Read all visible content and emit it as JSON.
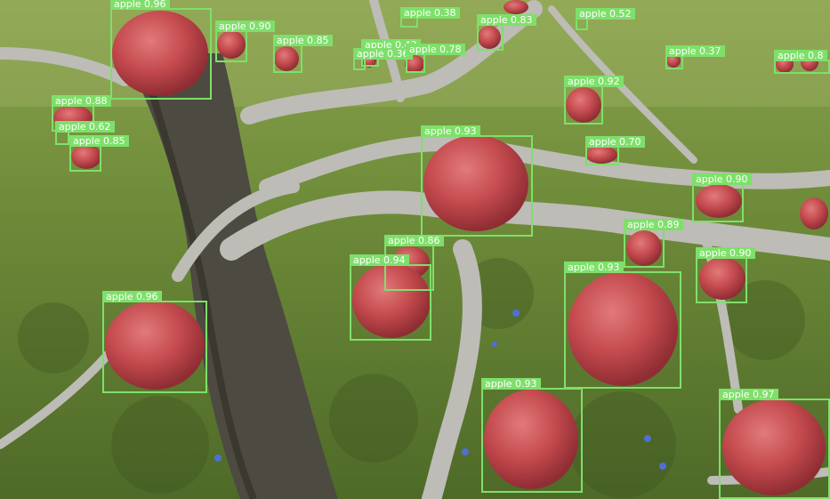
{
  "detections": [
    {
      "label": "apple",
      "score": "0.96"
    },
    {
      "label": "apple",
      "score": "0.90"
    },
    {
      "label": "apple",
      "score": "0.85"
    },
    {
      "label": "apple",
      "score": "0.43"
    },
    {
      "label": "apple",
      "score": "0.36"
    },
    {
      "label": "apple",
      "score": "0.78"
    },
    {
      "label": "apple",
      "score": "0.38"
    },
    {
      "label": "apple",
      "score": "0.83"
    },
    {
      "label": "apple",
      "score": "0.52"
    },
    {
      "label": "apple",
      "score": "0.37"
    },
    {
      "label": "apple",
      "score": "0.8"
    },
    {
      "label": "apple",
      "score": "0.92"
    },
    {
      "label": "apple",
      "score": "0.88"
    },
    {
      "label": "apple",
      "score": "0.62"
    },
    {
      "label": "apple",
      "score": "0.85"
    },
    {
      "label": "apple",
      "score": "0.93"
    },
    {
      "label": "apple",
      "score": "0.70"
    },
    {
      "label": "apple",
      "score": "0.90"
    },
    {
      "label": "apple",
      "score": "0.89"
    },
    {
      "label": "apple",
      "score": "0.86"
    },
    {
      "label": "apple",
      "score": "0.94"
    },
    {
      "label": "apple",
      "score": "0.93"
    },
    {
      "label": "apple",
      "score": "0.90"
    },
    {
      "label": "apple",
      "score": "0.96"
    },
    {
      "label": "apple",
      "score": "0.93"
    },
    {
      "label": "apple",
      "score": "0.97"
    }
  ]
}
